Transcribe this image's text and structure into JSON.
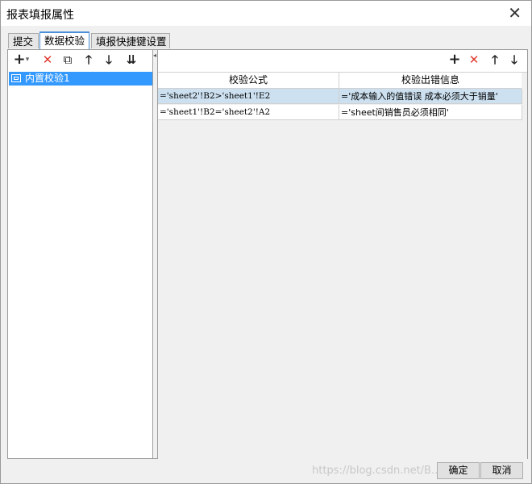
{
  "window": {
    "title": "报表填报属性",
    "close_symbol": "✕"
  },
  "tabs": [
    {
      "label": "提交"
    },
    {
      "label": "数据校验"
    },
    {
      "label": "填报快捷键设置"
    }
  ],
  "left_toolbar": {
    "add": "+",
    "add_dropdown": "▾",
    "delete": "✕",
    "copy": "⧉",
    "up": "🡑",
    "down": "🡓",
    "move_bottom": "⇊"
  },
  "tree": {
    "items": [
      {
        "label": "内置校验1"
      }
    ]
  },
  "right_toolbar": {
    "add": "+",
    "delete": "✕",
    "up": "🡑",
    "down": "🡓"
  },
  "table": {
    "headers": [
      "校验公式",
      "校验出错信息"
    ],
    "rows": [
      {
        "formula": "='sheet2'!B2>'sheet1'!E2",
        "message": "='成本输入的值错误 成本必须大于销量'"
      },
      {
        "formula": "='sheet1'!B2='sheet2'!A2",
        "message": "='sheet间销售员必须相同'"
      }
    ]
  },
  "footer": {
    "ok": "确定",
    "cancel": "取消"
  },
  "watermark": "https://blog.csdn.net/B..."
}
